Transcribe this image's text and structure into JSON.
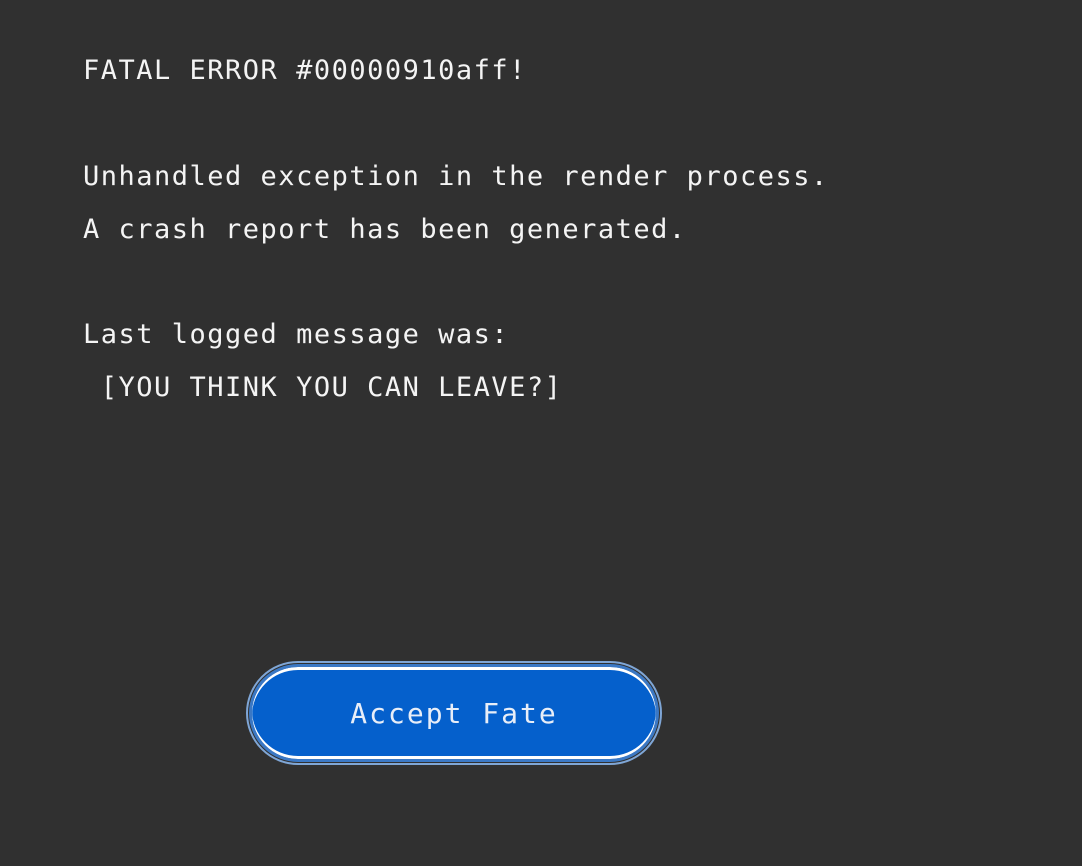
{
  "dialog": {
    "title": "FATAL ERROR #00000910aff!",
    "message_line_1": "Unhandled exception in the render process.",
    "message_line_2": "A crash report has been generated.",
    "last_message_label": "Last logged message was:",
    "last_message": " [YOU THINK YOU CAN LEAVE?]",
    "accept_button_label": "Accept Fate"
  },
  "colors": {
    "background": "#303030",
    "text": "#f4f4f4",
    "button": "#0560cc"
  }
}
